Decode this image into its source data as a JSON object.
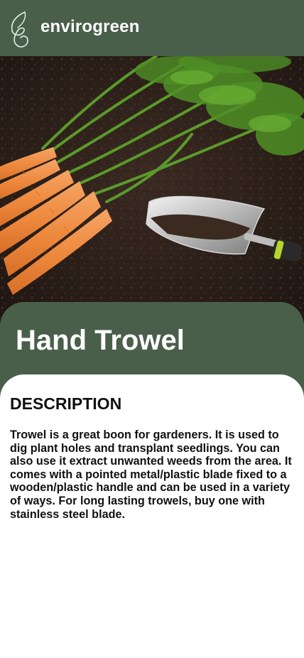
{
  "header": {
    "brand": "envirogreen",
    "logo_icon": "leaf-g-logo-icon",
    "background_color": "#4a5f4a"
  },
  "hero": {
    "image": "carrots-and-hand-trowel-on-soil"
  },
  "product": {
    "title": "Hand Trowel"
  },
  "description": {
    "heading": "DESCRIPTION",
    "body": "Trowel is a great boon for gardeners. It is used to dig plant holes and transplant seedlings. You can also use it extract unwanted weeds from the area. It comes with a pointed metal/plastic blade fixed to a wooden/plastic handle and can be used in a variety of ways. For long lasting trowels, buy one with stainless steel blade."
  }
}
